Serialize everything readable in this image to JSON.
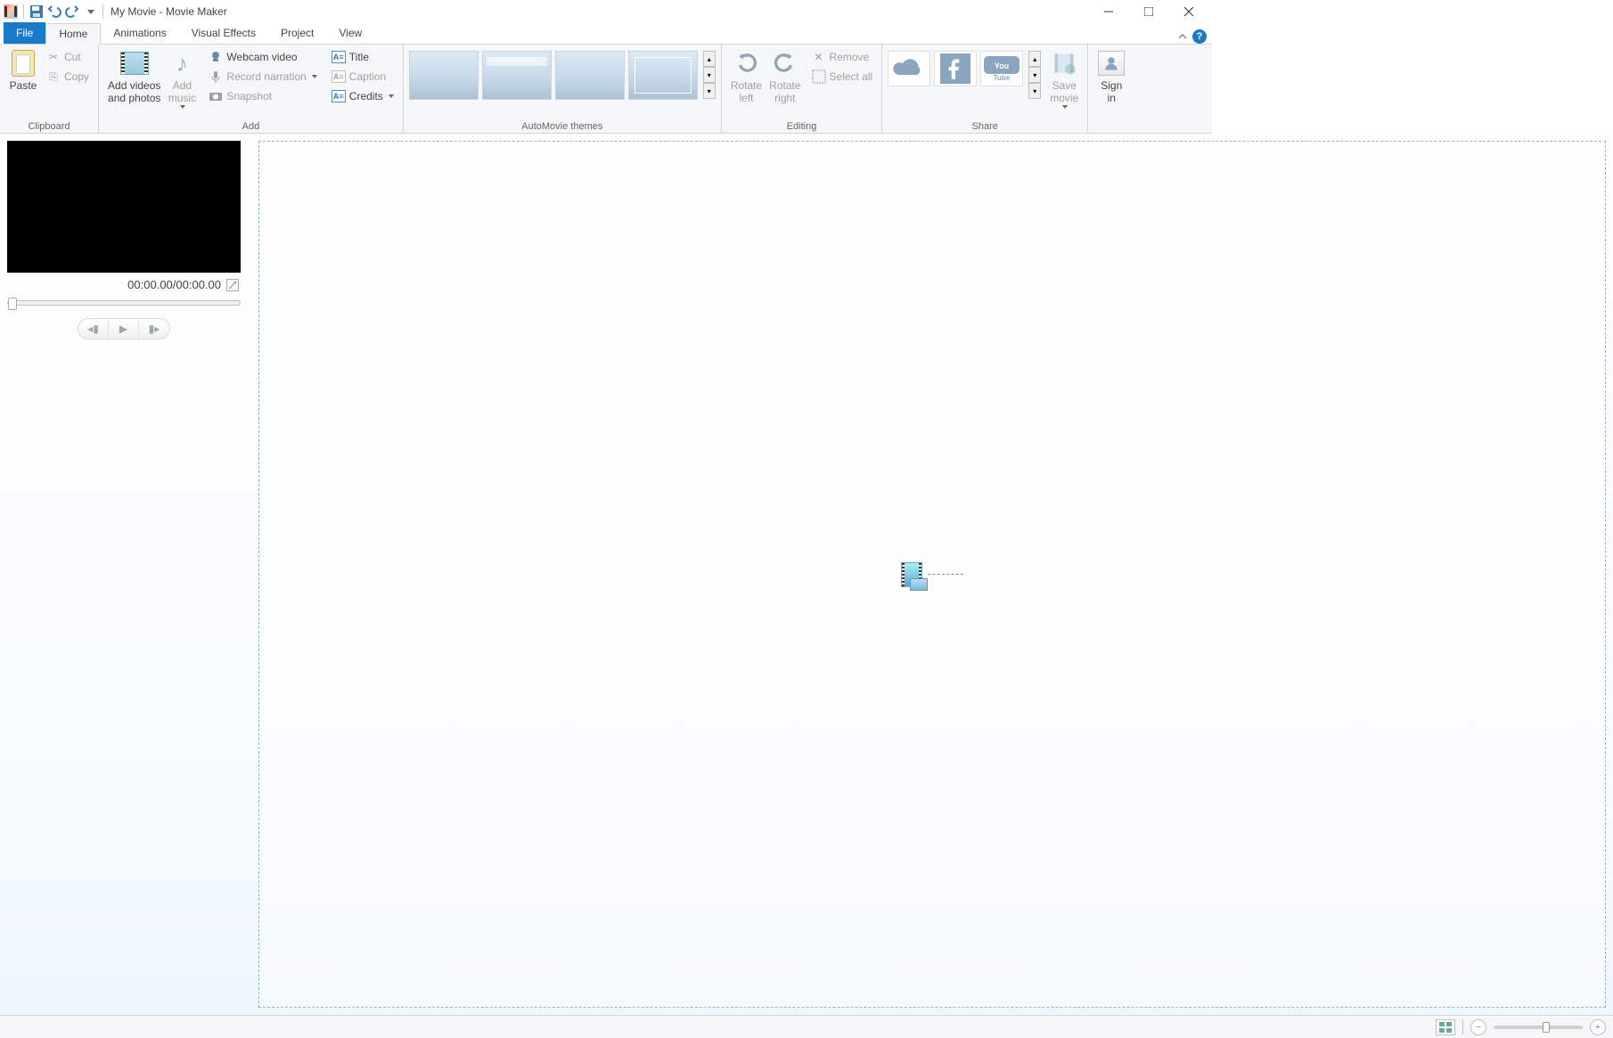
{
  "title": "My Movie - Movie Maker",
  "tabs": {
    "file": "File",
    "home": "Home",
    "animations": "Animations",
    "visual_effects": "Visual Effects",
    "project": "Project",
    "view": "View"
  },
  "ribbon": {
    "clipboard": {
      "label": "Clipboard",
      "paste": "Paste",
      "cut": "Cut",
      "copy": "Copy"
    },
    "add": {
      "label": "Add",
      "add_media": "Add videos\nand photos",
      "add_music": "Add\nmusic",
      "webcam": "Webcam video",
      "narration": "Record narration",
      "snapshot": "Snapshot",
      "title": "Title",
      "caption": "Caption",
      "credits": "Credits"
    },
    "automovie": {
      "label": "AutoMovie themes"
    },
    "editing": {
      "label": "Editing",
      "rotate_left": "Rotate\nleft",
      "rotate_right": "Rotate\nright",
      "remove": "Remove",
      "select_all": "Select all"
    },
    "share": {
      "label": "Share",
      "save_movie": "Save\nmovie",
      "sign_in": "Sign\nin"
    }
  },
  "preview": {
    "time": "00:00.00/00:00.00"
  },
  "status": {}
}
